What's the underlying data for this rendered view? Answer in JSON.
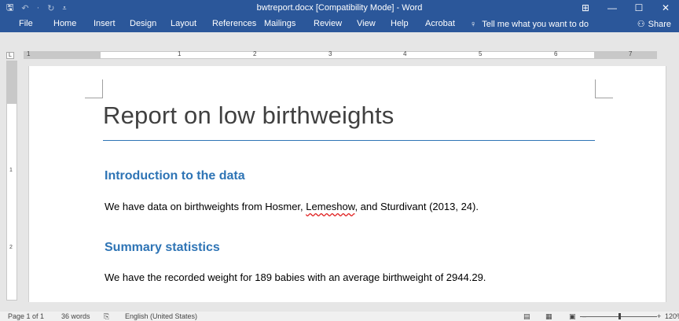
{
  "window": {
    "title": "bwtreport.docx [Compatibility Mode]  -  Word",
    "accent": "#2b579a"
  },
  "quick_access": {
    "save_icon": "save-icon",
    "undo_icon": "undo-icon",
    "redo_icon": "redo-icon",
    "customize_icon": "customize-icon",
    "save_glyph": "🖫",
    "undo_glyph": "↶",
    "sep": "·",
    "redo_glyph": "↻",
    "customize_glyph": "⩡"
  },
  "window_controls": {
    "ribbon_display": "⊞",
    "minimize": "—",
    "maximize": "☐",
    "close": "✕"
  },
  "ribbon": {
    "tabs": [
      "File",
      "Home",
      "Insert",
      "Design",
      "Layout",
      "References",
      "Mailings",
      "Review",
      "View",
      "Help",
      "Acrobat"
    ],
    "tell_me": "Tell me what you want to do",
    "tell_me_glyph": "♀",
    "share": "Share",
    "share_glyph": "⚇"
  },
  "ruler": {
    "numbers": [
      "1",
      "1",
      "2",
      "3",
      "4",
      "5",
      "6",
      "7"
    ],
    "corner_glyph": "L"
  },
  "vruler": {
    "numbers": [
      "1",
      "2"
    ]
  },
  "document": {
    "title": "Report on low birthweights",
    "heading_color": "#2e74b5",
    "sections": [
      {
        "heading": "Introduction to the data",
        "text_before": "We have data on birthweights from Hosmer, ",
        "text_misspelled": "Lemeshow",
        "text_after": ", and Sturdivant (2013, 24)."
      },
      {
        "heading": "Summary statistics",
        "text": "We have the recorded weight for 189 babies with an average birthweight of 2944.29."
      }
    ]
  },
  "status": {
    "page": "Page 1 of 1",
    "words": "36 words",
    "proofing_glyph": "⎘",
    "language": "English (United States)",
    "read_mode_glyph": "▤",
    "print_layout_glyph": "▦",
    "web_layout_glyph": "▣",
    "zoom_out": "–",
    "zoom_in": "+",
    "zoom": "120%"
  }
}
